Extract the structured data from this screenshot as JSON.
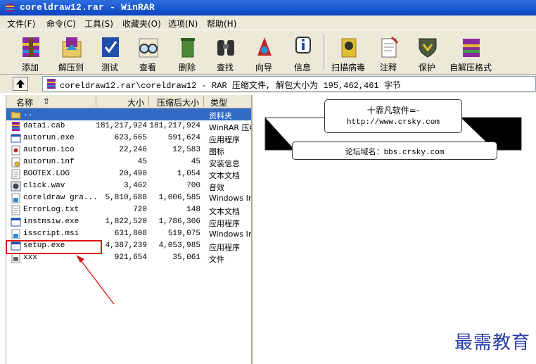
{
  "window": {
    "title": "coreldraw12.rar - WinRAR"
  },
  "menu": [
    "文件(F)",
    "命令(C)",
    "工具(S)",
    "收藏夹(O)",
    "选项(N)",
    "帮助(H)"
  ],
  "toolbar": [
    "添加",
    "解压到",
    "测试",
    "查看",
    "删除",
    "查找",
    "向导",
    "信息",
    "扫描病毒",
    "注释",
    "保护",
    "自解压格式"
  ],
  "path": {
    "text": "coreldraw12.rar\\coreldraw12 - RAR 压缩文件, 解包大小为 195,462,461 字节"
  },
  "columns": {
    "name": "名称",
    "size": "大小",
    "packed": "压缩后大小",
    "type": "类型"
  },
  "files": [
    {
      "name": "..",
      "size": "",
      "packed": "",
      "type": "资料夹",
      "icon": "folder-up-icon",
      "selected": true
    },
    {
      "name": "data1.cab",
      "size": "181,217,924",
      "packed": "181,217,924",
      "type": "WinRAR 压缩",
      "icon": "archive-icon"
    },
    {
      "name": "autorun.exe",
      "size": "623,665",
      "packed": "591,624",
      "type": "应用程序",
      "icon": "exe-icon"
    },
    {
      "name": "autorun.ico",
      "size": "22,246",
      "packed": "12,583",
      "type": "图标",
      "icon": "ico-file-icon"
    },
    {
      "name": "autorun.inf",
      "size": "45",
      "packed": "45",
      "type": "安装信息",
      "icon": "inf-file-icon"
    },
    {
      "name": "BOOTEX.LOG",
      "size": "20,490",
      "packed": "1,054",
      "type": "文本文档",
      "icon": "text-file-icon"
    },
    {
      "name": "click.wav",
      "size": "3,462",
      "packed": "700",
      "type": "音效",
      "icon": "wav-file-icon"
    },
    {
      "name": "coreldraw gra...",
      "size": "5,810,688",
      "packed": "1,006,585",
      "type": "Windows In",
      "icon": "msi-file-icon"
    },
    {
      "name": "ErrorLog.txt",
      "size": "720",
      "packed": "148",
      "type": "文本文档",
      "icon": "text-file-icon"
    },
    {
      "name": "instmsiw.exe",
      "size": "1,822,520",
      "packed": "1,786,306",
      "type": "应用程序",
      "icon": "exe-icon"
    },
    {
      "name": "isscript.msi",
      "size": "631,808",
      "packed": "519,075",
      "type": "Windows In",
      "icon": "msi-file-icon"
    },
    {
      "name": "setup.exe",
      "size": "4,387,239",
      "packed": "4,053,985",
      "type": "应用程序",
      "icon": "exe-icon"
    },
    {
      "name": "xxx",
      "size": "921,654",
      "packed": "35,061",
      "type": "文件",
      "icon": "generic-file-icon"
    }
  ],
  "comment": {
    "line1": "十霏凡软件=-",
    "line2": "http://www.crsky.com",
    "line3": "论坛域名：bbs.crsky.com"
  },
  "watermark": "最需教育",
  "colors": {
    "title_bar": "#0a44c0",
    "selection": "#316ac5",
    "highlight_box": "#dd1111",
    "watermark": "#2a3ea8"
  }
}
